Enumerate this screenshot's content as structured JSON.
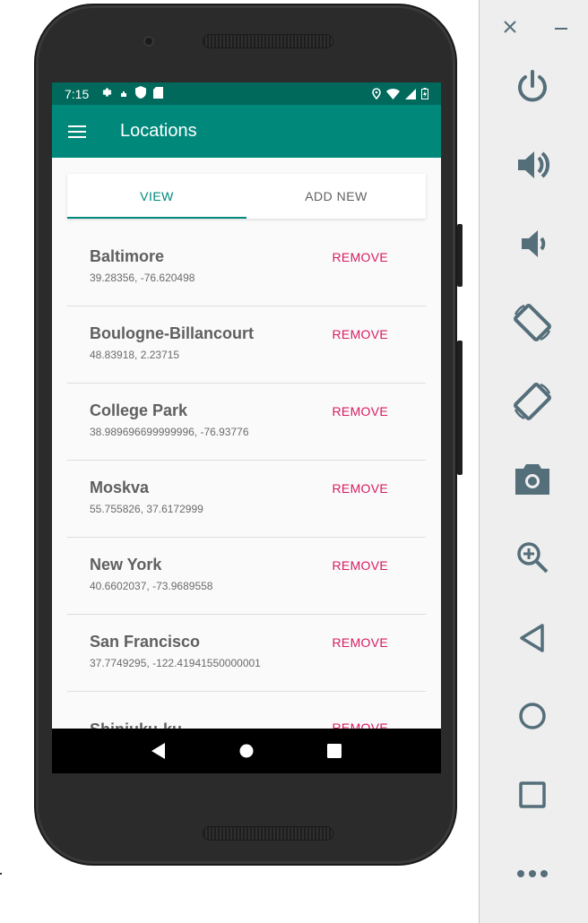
{
  "status_bar": {
    "time": "7:15"
  },
  "app_bar": {
    "title": "Locations"
  },
  "tabs": [
    {
      "label": "VIEW",
      "active": true
    },
    {
      "label": "ADD NEW",
      "active": false
    }
  ],
  "locations": [
    {
      "name": "Baltimore",
      "coords": "39.28356, -76.620498",
      "action": "REMOVE"
    },
    {
      "name": "Boulogne-Billancourt",
      "coords": "48.83918, 2.23715",
      "action": "REMOVE"
    },
    {
      "name": "College Park",
      "coords": "38.989696699999996, -76.93776",
      "action": "REMOVE"
    },
    {
      "name": "Moskva",
      "coords": "55.755826, 37.6172999",
      "action": "REMOVE"
    },
    {
      "name": "New York",
      "coords": "40.6602037, -73.9689558",
      "action": "REMOVE"
    },
    {
      "name": "San Francisco",
      "coords": "37.7749295, -122.41941550000001",
      "action": "REMOVE"
    },
    {
      "name": "Shinjuku-ku",
      "coords": "",
      "action": "REMOVE"
    }
  ],
  "colors": {
    "primary": "#00897b",
    "primary_dark": "#00695c",
    "accent": "#d81b60",
    "panel_icon": "#546e7a"
  },
  "emulator_controls": [
    "close-icon",
    "minimize-icon",
    "power-icon",
    "volume-up-icon",
    "volume-down-icon",
    "rotate-left-icon",
    "rotate-right-icon",
    "camera-icon",
    "zoom-icon",
    "back-icon",
    "home-icon",
    "overview-icon",
    "more-icon"
  ]
}
